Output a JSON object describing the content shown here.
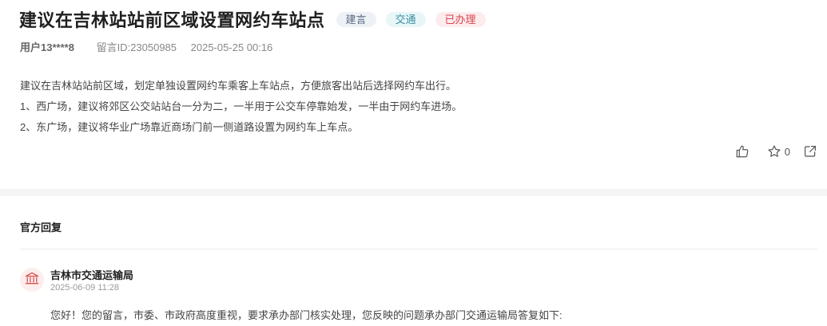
{
  "post": {
    "title": "建议在吉林站站前区域设置网约车站点",
    "tags": [
      "建言",
      "交通",
      "已办理"
    ],
    "user": "用户13****8",
    "message_id": "留言ID:23050985",
    "datetime": "2025-05-25 00:16",
    "body": [
      "建议在吉林站站前区域，划定单独设置网约车乘客上车站点，方便旅客出站后选择网约车出行。",
      "1、西广场，建议将郊区公交站站台一分为二，一半用于公交车停靠始发，一半由于网约车进场。",
      "2、东广场，建议将华业广场靠近商场门前一侧道路设置为网约车上车点。"
    ],
    "favorite_count": "0"
  },
  "reply": {
    "section_title": "官方回复",
    "org_name": "吉林市交通运输局",
    "date": "2025-06-09 11:28",
    "text": "您好！您的留言，市委、市政府高度重视，要求承办部门核实处理，您反映的问题承办部门交通运输局答复如下:"
  },
  "icons": {
    "like": "thumbs-up-icon",
    "favorite": "star-icon",
    "share": "share-icon",
    "org": "government-building-icon"
  },
  "colors": {
    "tag_suggest": "#5b6b80",
    "tag_traffic": "#3e8fa3",
    "tag_done": "#d9434f",
    "org_icon": "#d9534f"
  }
}
